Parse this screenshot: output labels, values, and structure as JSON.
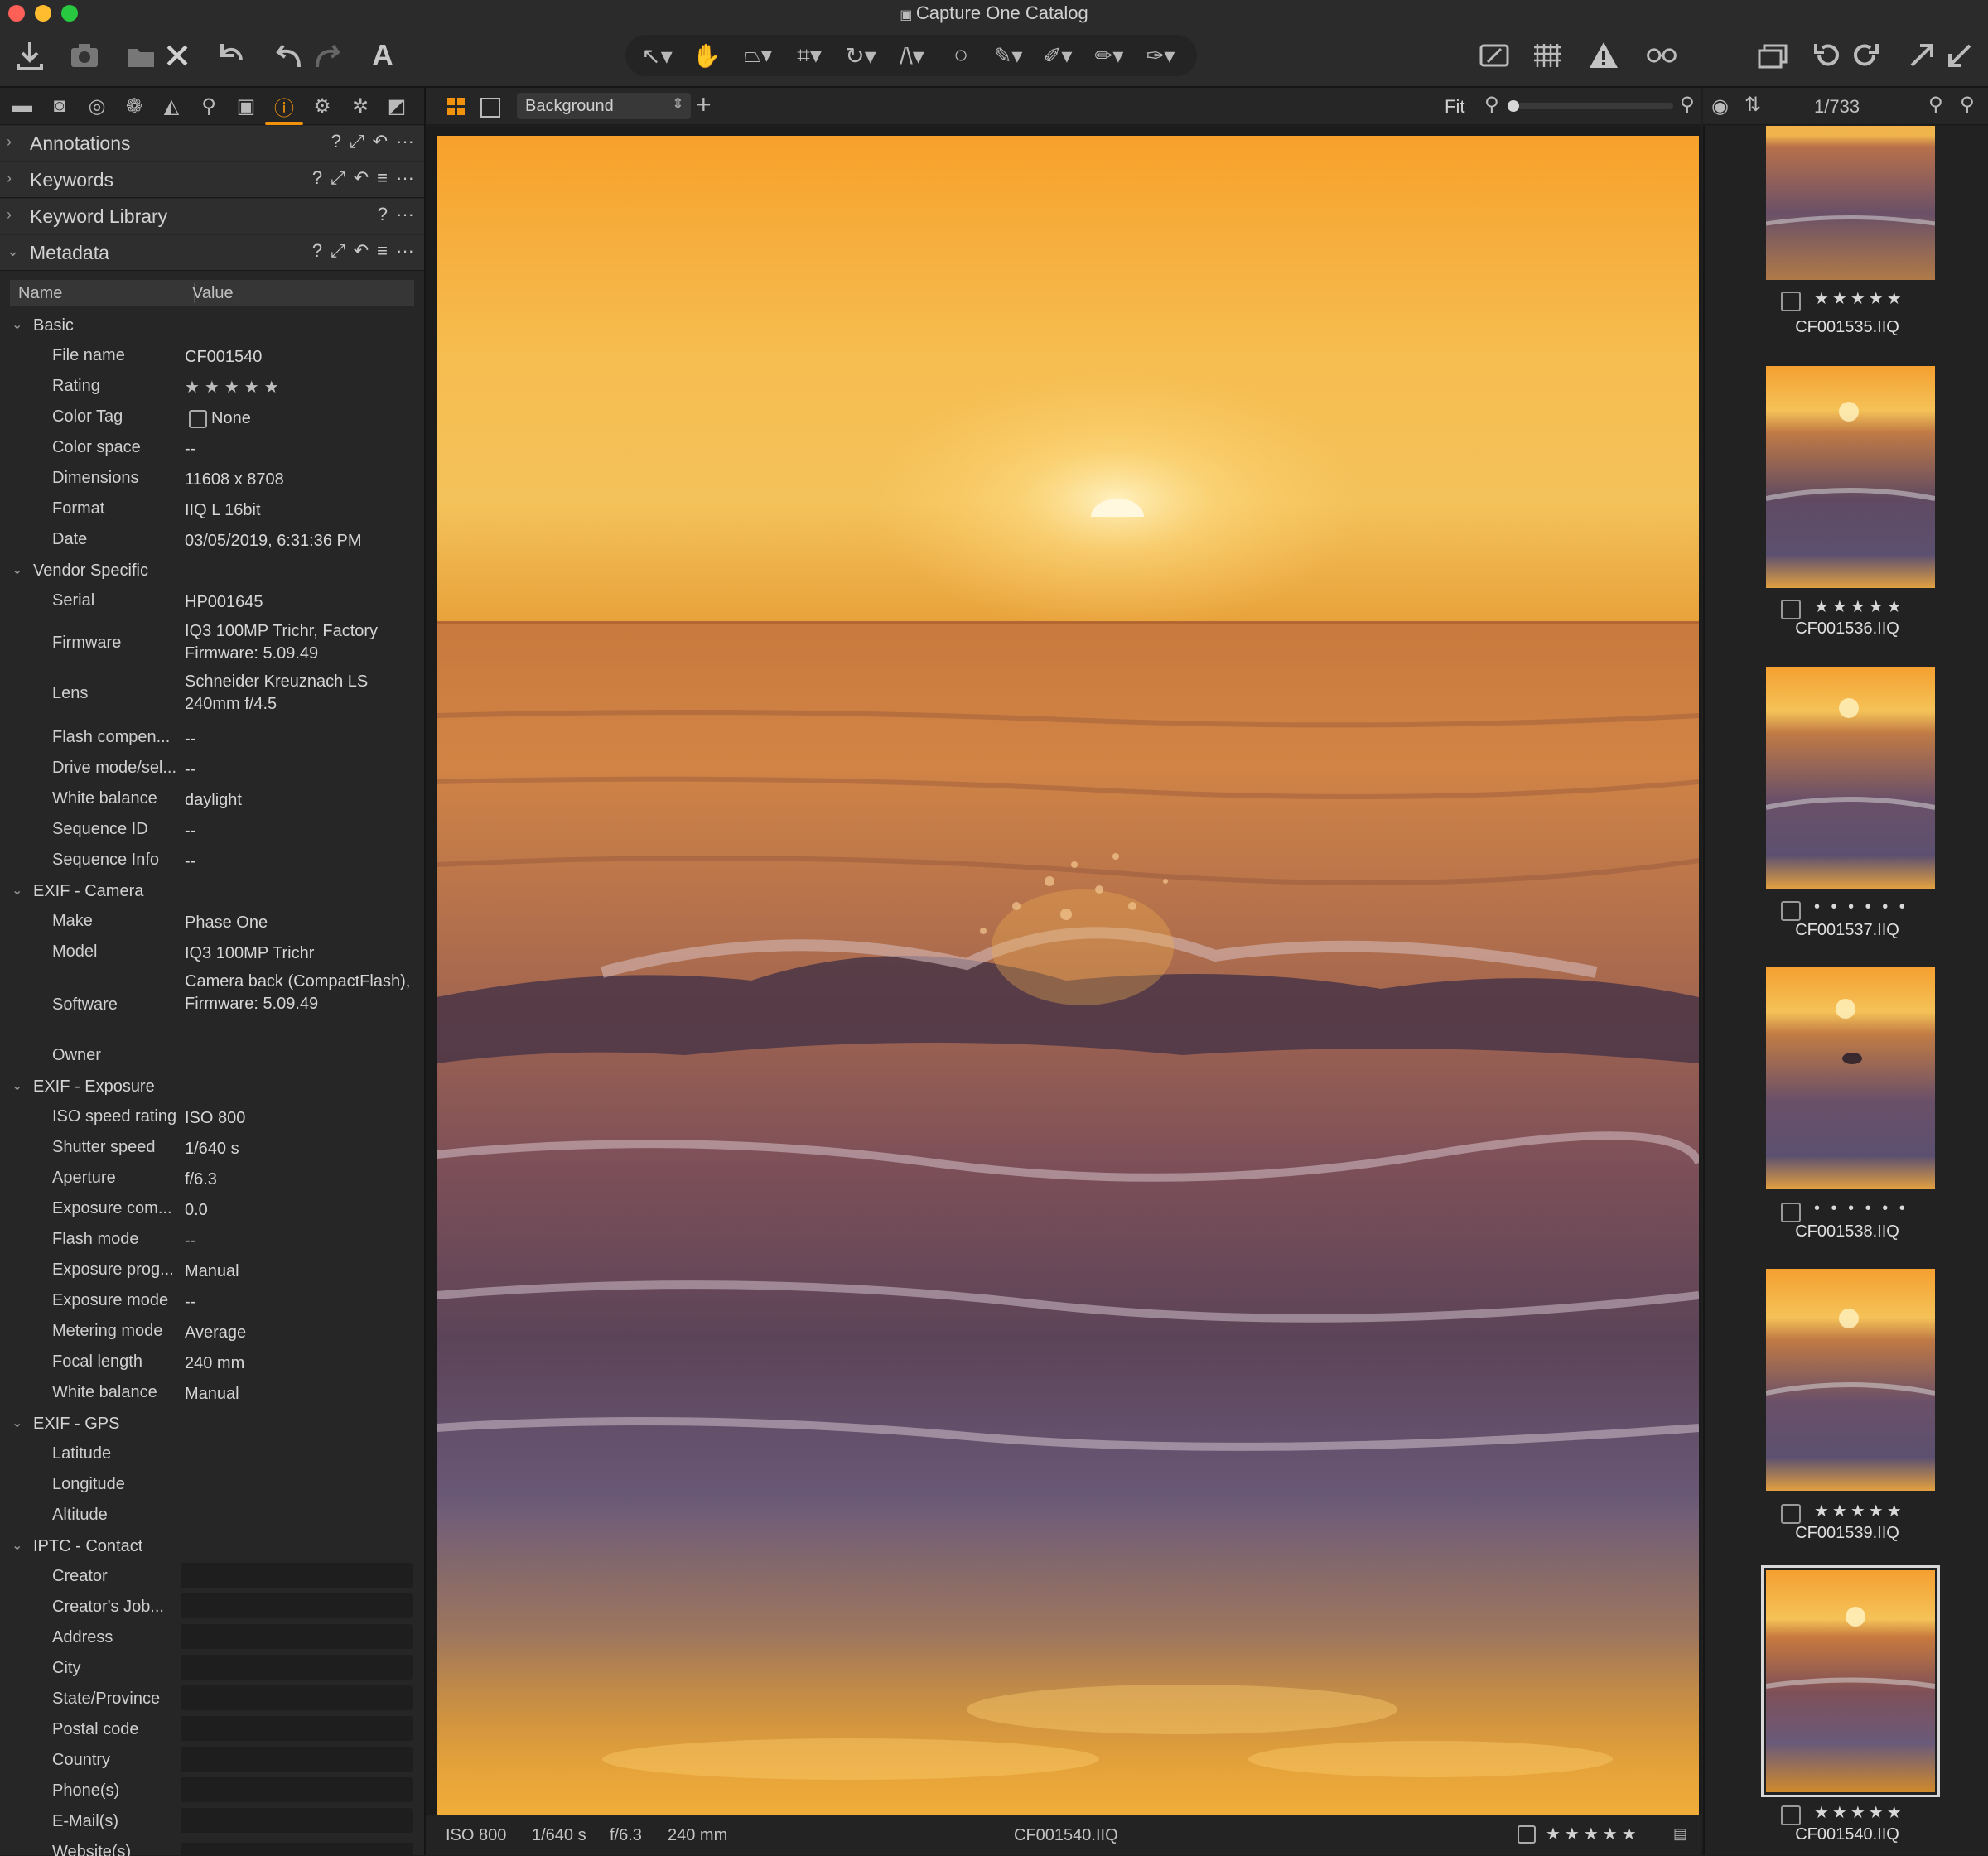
{
  "window": {
    "title": "Capture One Catalog"
  },
  "toolbar": {
    "icons": [
      "import-icon",
      "capture-icon",
      "move-to-icon",
      "delete-icon",
      "undo-history-icon",
      "undo-icon",
      "redo-icon",
      "text-icon",
      "select-icon",
      "pan-icon",
      "keystone-icon",
      "crop-icon",
      "rotate-icon",
      "straighten-icon",
      "spot-icon",
      "brush-icon",
      "erase-icon",
      "gradient-icon",
      "radial-icon",
      "overlay-icon",
      "grid-icon",
      "warning-icon",
      "proof-icon",
      "copy-window-icon",
      "rotate-left-icon",
      "rotate-right-icon",
      "copy-adjust-icon",
      "apply-adjust-icon"
    ]
  },
  "left": {
    "sections": [
      {
        "label": "Annotations",
        "expanded": false
      },
      {
        "label": "Keywords",
        "expanded": false
      },
      {
        "label": "Keyword Library",
        "expanded": false
      },
      {
        "label": "Metadata",
        "expanded": true
      }
    ],
    "meta_header": {
      "name": "Name",
      "value": "Value"
    },
    "groups": {
      "basic": "Basic",
      "vendor": "Vendor Specific",
      "exif_camera": "EXIF - Camera",
      "exif_exposure": "EXIF - Exposure",
      "exif_gps": "EXIF - GPS",
      "iptc_contact": "IPTC - Contact"
    },
    "basic": {
      "file_name": {
        "k": "File name",
        "v": "CF001540"
      },
      "rating": {
        "k": "Rating",
        "v": "★★★★★"
      },
      "color_tag": {
        "k": "Color Tag",
        "v": "None"
      },
      "color_space": {
        "k": "Color space",
        "v": "--"
      },
      "dimensions": {
        "k": "Dimensions",
        "v": "11608 x 8708"
      },
      "format": {
        "k": "Format",
        "v": "IIQ L 16bit"
      },
      "date": {
        "k": "Date",
        "v": "03/05/2019, 6:31:36 PM"
      }
    },
    "vendor": {
      "serial": {
        "k": "Serial",
        "v": "HP001645"
      },
      "firmware": {
        "k": "Firmware",
        "v": "IQ3 100MP Trichr, Factory Firmware: 5.09.49"
      },
      "lens": {
        "k": "Lens",
        "v": "Schneider Kreuznach LS 240mm f/4.5"
      },
      "flash_comp": {
        "k": "Flash compen...",
        "v": "--"
      },
      "drive_mode": {
        "k": "Drive mode/sel...",
        "v": "--"
      },
      "white_balance": {
        "k": "White balance",
        "v": "daylight"
      },
      "sequence_id": {
        "k": "Sequence ID",
        "v": "--"
      },
      "sequence_info": {
        "k": "Sequence Info",
        "v": "--"
      }
    },
    "camera": {
      "make": {
        "k": "Make",
        "v": "Phase One"
      },
      "model": {
        "k": "Model",
        "v": "IQ3 100MP Trichr"
      },
      "software": {
        "k": "Software",
        "v": "Camera back (CompactFlash), Firmware: 5.09.49"
      },
      "owner": {
        "k": "Owner",
        "v": ""
      }
    },
    "exposure": {
      "iso": {
        "k": "ISO speed rating",
        "v": "ISO 800"
      },
      "shutter": {
        "k": "Shutter speed",
        "v": "1/640 s"
      },
      "aperture": {
        "k": "Aperture",
        "v": "f/6.3"
      },
      "exp_comp": {
        "k": "Exposure com...",
        "v": "0.0"
      },
      "flash_mode": {
        "k": "Flash mode",
        "v": "--"
      },
      "exp_prog": {
        "k": "Exposure prog...",
        "v": "Manual"
      },
      "exp_mode": {
        "k": "Exposure mode",
        "v": "--"
      },
      "metering": {
        "k": "Metering mode",
        "v": "Average"
      },
      "focal": {
        "k": "Focal length",
        "v": "240 mm"
      },
      "wb": {
        "k": "White balance",
        "v": "Manual"
      }
    },
    "gps": {
      "lat": {
        "k": "Latitude"
      },
      "lon": {
        "k": "Longitude"
      },
      "alt": {
        "k": "Altitude"
      }
    },
    "iptc": {
      "creator": "Creator",
      "job": "Creator's Job...",
      "address": "Address",
      "city": "City",
      "state": "State/Province",
      "postal": "Postal code",
      "country": "Country",
      "phone": "Phone(s)",
      "email": "E-Mail(s)",
      "website": "Website(s)"
    }
  },
  "viewer": {
    "layer": "Background",
    "zoom_label": "Fit",
    "zoom_level": 0.05
  },
  "status": {
    "iso": "ISO 800",
    "shutter": "1/640 s",
    "aperture": "f/6.3",
    "focal": "240 mm",
    "file": "CF001540.IIQ",
    "stars": "★★★★★"
  },
  "browser": {
    "counter": "1/733",
    "thumbs": [
      {
        "name": "CF001535.IIQ",
        "stars": "★★★★★"
      },
      {
        "name": "CF001536.IIQ",
        "stars": "★★★★★"
      },
      {
        "name": "CF001537.IIQ",
        "stars": "• • • • • •"
      },
      {
        "name": "CF001538.IIQ",
        "stars": "• • • • • •"
      },
      {
        "name": "CF001539.IIQ",
        "stars": "★★★★★"
      },
      {
        "name": "CF001540.IIQ",
        "stars": "★★★★★"
      }
    ]
  },
  "colors": {
    "accent": "#f0920c",
    "panel": "#262626",
    "background": "#1f1f1f"
  }
}
